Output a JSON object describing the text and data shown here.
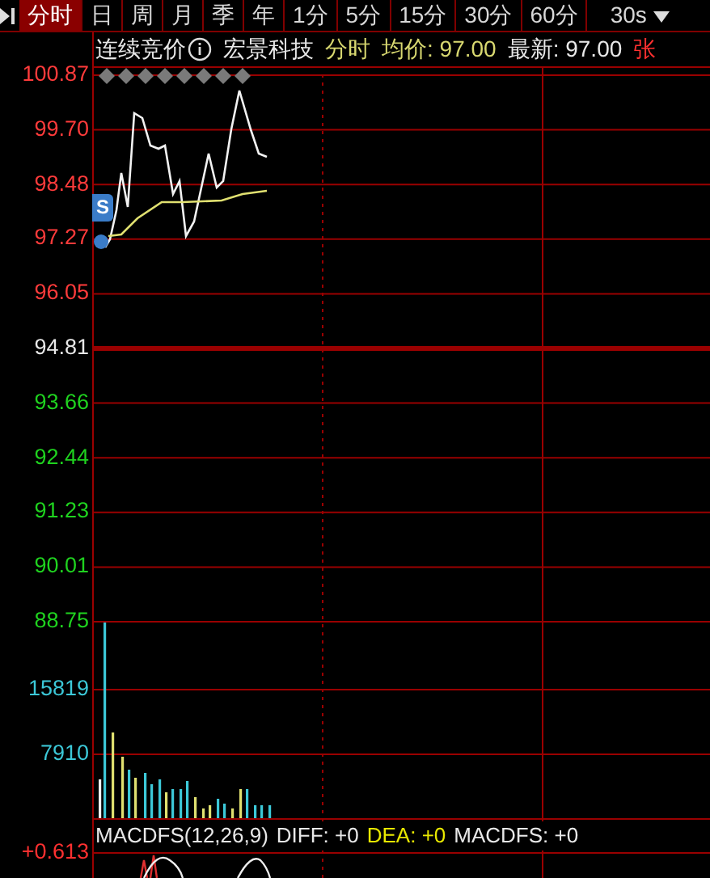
{
  "tabs": [
    {
      "label": "分时",
      "selected": true
    },
    {
      "label": "日",
      "selected": false
    },
    {
      "label": "周",
      "selected": false
    },
    {
      "label": "月",
      "selected": false
    },
    {
      "label": "季",
      "selected": false
    },
    {
      "label": "年",
      "selected": false
    },
    {
      "label": "1分",
      "selected": false
    },
    {
      "label": "5分",
      "selected": false
    },
    {
      "label": "15分",
      "selected": false
    },
    {
      "label": "30分",
      "selected": false
    },
    {
      "label": "60分",
      "selected": false
    },
    {
      "label": "30s",
      "selected": false
    }
  ],
  "info": {
    "session": "连续竞价",
    "stock": "宏景科技",
    "mode": "分时",
    "avg_price": "均价: 97.00",
    "latest": "最新: 97.00",
    "limit": "张"
  },
  "price_axis": [
    {
      "label": "100.87",
      "kind": "up"
    },
    {
      "label": "99.70",
      "kind": "up"
    },
    {
      "label": "98.48",
      "kind": "up"
    },
    {
      "label": "97.27",
      "kind": "up"
    },
    {
      "label": "96.05",
      "kind": "up"
    },
    {
      "label": "94.81",
      "kind": "flat"
    },
    {
      "label": "93.66",
      "kind": "down"
    },
    {
      "label": "92.44",
      "kind": "down"
    },
    {
      "label": "91.23",
      "kind": "down"
    },
    {
      "label": "90.01",
      "kind": "down"
    },
    {
      "label": "88.75",
      "kind": "down"
    }
  ],
  "signal_badge": "S",
  "volume_axis": [
    "15819",
    "7910"
  ],
  "macd": {
    "title": "MACDFS(12,26,9)",
    "diff": "DIFF: +0",
    "dea": "DEA: +0",
    "value": "MACDFS: +0",
    "axis_label": "+0.613"
  }
}
